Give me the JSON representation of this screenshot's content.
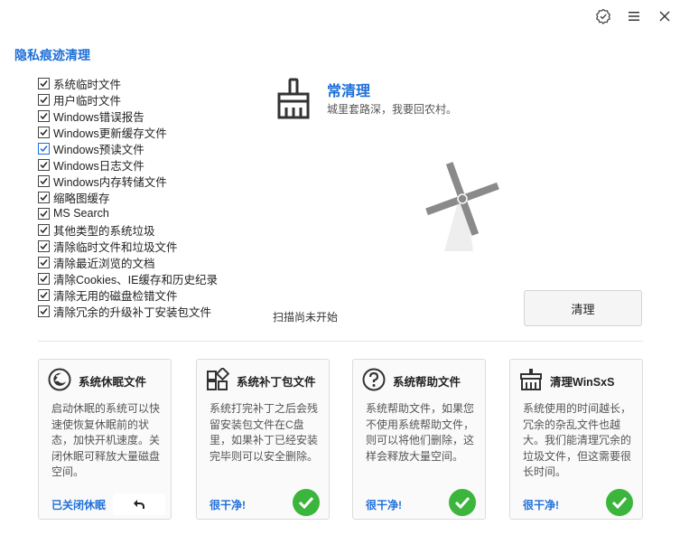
{
  "window": {
    "icons": [
      "badge-check-icon",
      "menu-icon",
      "close-icon"
    ]
  },
  "section_title": "隐私痕迹清理",
  "checklist": [
    {
      "label": "系统临时文件",
      "checked": true
    },
    {
      "label": "用户临时文件",
      "checked": true
    },
    {
      "label": "Windows错误报告",
      "checked": true
    },
    {
      "label": "Windows更新缓存文件",
      "checked": true
    },
    {
      "label": "Windows预读文件",
      "checked": true
    },
    {
      "label": "Windows日志文件",
      "checked": true
    },
    {
      "label": "Windows内存转储文件",
      "checked": true
    },
    {
      "label": "缩略图缓存",
      "checked": true
    },
    {
      "label": "MS Search",
      "checked": true
    },
    {
      "label": "其他类型的系统垃圾",
      "checked": true
    },
    {
      "label": "清除临时文件和垃圾文件",
      "checked": true
    },
    {
      "label": "清除最近浏览的文档",
      "checked": true
    },
    {
      "label": "清除Cookies、IE缓存和历史纪录",
      "checked": true
    },
    {
      "label": "清除无用的磁盘检错文件",
      "checked": true
    },
    {
      "label": "清除冗余的升级补丁安装包文件",
      "checked": true
    }
  ],
  "hero": {
    "icon": "broom-icon",
    "title": "常清理",
    "subtitle": "城里套路深，我要回农村。"
  },
  "scan_status": "扫描尚未开始",
  "clean_button": "清理",
  "cards": [
    {
      "icon": "sleep-icon",
      "title": "系统休眠文件",
      "body": "启动休眠的系统可以快速使恢复休眠前的状态，加快开机速度。关闭休眠可释放大量磁盘空间。",
      "status": "已关闭休眠",
      "action": "undo-icon"
    },
    {
      "icon": "patch-icon",
      "title": "系统补丁包文件",
      "body": "系统打完补丁之后会残留安装包文件在C盘里，如果补丁已经安装完毕则可以安全删除。",
      "status": "很干净!",
      "action": "check-icon"
    },
    {
      "icon": "help-icon",
      "title": "系统帮助文件",
      "body": "系统帮助文件，如果您不使用系统帮助文件，则可以将他们删除，这样会释放大量空间。",
      "status": "很干净!",
      "action": "check-icon"
    },
    {
      "icon": "winsxs-icon",
      "title": "清理WinSxS",
      "body": "系统使用的时间越长，冗余的杂乱文件也越大。我们能清理冗余的垃圾文件，但这需要很长时间。",
      "status": "很干净!",
      "action": "check-icon"
    }
  ]
}
